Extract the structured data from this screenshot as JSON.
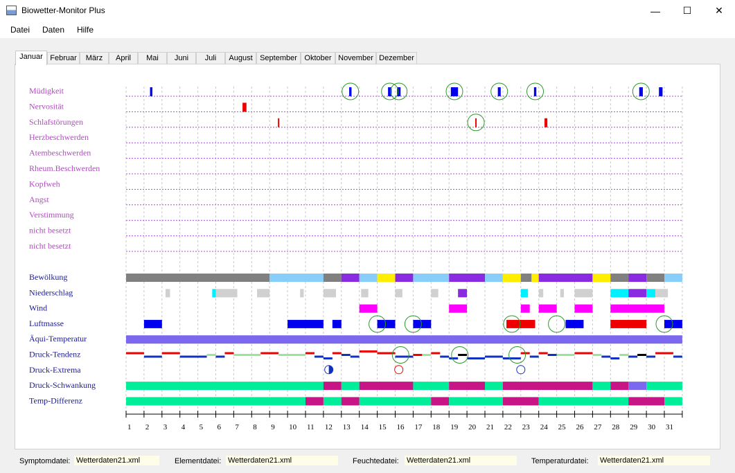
{
  "window": {
    "title": "Biowetter-Monitor Plus",
    "minimize": "—",
    "maximize": "☐",
    "close": "✕",
    "icon": "app-icon"
  },
  "menu": [
    "Datei",
    "Daten",
    "Hilfe"
  ],
  "tabs": [
    "Januar",
    "Februar",
    "März",
    "April",
    "Mai",
    "Juni",
    "Juli",
    "August",
    "September",
    "Oktober",
    "November",
    "Dezember"
  ],
  "active_tab": "Januar",
  "symptoms": [
    "Müdigkeit",
    "Nervosität",
    "Schlafstörungen",
    "Herzbeschwerden",
    "Atembeschwerden",
    "Rheum.Beschwerden",
    "Kopfweh",
    "Angst",
    "Verstimmung",
    "nicht besetzt",
    "nicht besetzt"
  ],
  "elements": [
    "Bewölkung",
    "Niederschlag",
    "Wind",
    "Luftmasse",
    "Äqui-Temperatur",
    "Druck-Tendenz",
    "Druck-Extrema",
    "Druck-Schwankung",
    "Temp-Differenz"
  ],
  "days": [
    "1",
    "2",
    "3",
    "4",
    "5",
    "6",
    "7",
    "8",
    "9",
    "10",
    "11",
    "12",
    "13",
    "14",
    "15",
    "16",
    "17",
    "18",
    "19",
    "20",
    "21",
    "22",
    "23",
    "24",
    "25",
    "26",
    "27",
    "28",
    "29",
    "30",
    "31"
  ],
  "colors": {
    "symptom_label": "#b04cc0",
    "element_label": "#1a1a99",
    "guide": "#a34fd0",
    "vgrid": "#c8c8c8",
    "blue": "#0000ee",
    "red": "#ee0000",
    "circle": "#2a9a2a",
    "gray": "#808080",
    "skyblue": "#87cefa",
    "purple": "#8a2be2",
    "yellow": "#ffee00",
    "lightgray": "#d0d0d0",
    "cyan": "#00f0ff",
    "magenta": "#ff00ff",
    "slate": "#7b68ee",
    "green": "#00ee99",
    "crimson": "#c71585",
    "lightgreen": "#98e698",
    "darkblue": "#1030c0",
    "black": "#000000"
  },
  "status": [
    {
      "label": "Symptomdatei:",
      "value": "Wetterdaten21.xml"
    },
    {
      "label": "Elementdatei:",
      "value": "Wetterdaten21.xml"
    },
    {
      "label": "Feuchtedatei:",
      "value": "Wetterdaten21.xml"
    },
    {
      "label": "Temperaturdatei:",
      "value": "Wetterdaten21.xml"
    }
  ],
  "chart_data": {
    "type": "timeline",
    "x_range": [
      1,
      31
    ],
    "symptom_marks": [
      {
        "row": 0,
        "day": 2.4,
        "w": 0.13,
        "color": "blue"
      },
      {
        "row": 0,
        "day": 13.5,
        "w": 0.13,
        "color": "blue"
      },
      {
        "row": 0,
        "day": 15.7,
        "w": 0.2,
        "color": "blue"
      },
      {
        "row": 0,
        "day": 16.2,
        "w": 0.2,
        "color": "blue"
      },
      {
        "row": 0,
        "day": 19.3,
        "w": 0.4,
        "color": "blue"
      },
      {
        "row": 0,
        "day": 21.8,
        "w": 0.16,
        "color": "blue"
      },
      {
        "row": 0,
        "day": 23.8,
        "w": 0.13,
        "color": "blue"
      },
      {
        "row": 0,
        "day": 29.7,
        "w": 0.2,
        "color": "blue"
      },
      {
        "row": 0,
        "day": 30.8,
        "w": 0.2,
        "color": "blue"
      },
      {
        "row": 1,
        "day": 7.6,
        "w": 0.22,
        "color": "red"
      },
      {
        "row": 2,
        "day": 9.5,
        "w": 0.07,
        "color": "red"
      },
      {
        "row": 2,
        "day": 20.5,
        "w": 0.07,
        "color": "red"
      },
      {
        "row": 2,
        "day": 24.4,
        "w": 0.16,
        "color": "red"
      }
    ],
    "symptom_circles": [
      {
        "row": 0,
        "day": 13.5
      },
      {
        "row": 0,
        "day": 15.7
      },
      {
        "row": 0,
        "day": 16.2
      },
      {
        "row": 0,
        "day": 19.3
      },
      {
        "row": 0,
        "day": 21.8
      },
      {
        "row": 0,
        "day": 23.8
      },
      {
        "row": 0,
        "day": 29.7
      },
      {
        "row": 2,
        "day": 20.5
      }
    ],
    "element_bars": [
      {
        "row": 0,
        "from": 1,
        "to": 9,
        "color": "gray"
      },
      {
        "row": 0,
        "from": 9,
        "to": 12,
        "color": "skyblue"
      },
      {
        "row": 0,
        "from": 12,
        "to": 13,
        "color": "gray"
      },
      {
        "row": 0,
        "from": 13,
        "to": 14,
        "color": "purple"
      },
      {
        "row": 0,
        "from": 14,
        "to": 15,
        "color": "skyblue"
      },
      {
        "row": 0,
        "from": 15,
        "to": 16,
        "color": "yellow"
      },
      {
        "row": 0,
        "from": 16,
        "to": 17,
        "color": "purple"
      },
      {
        "row": 0,
        "from": 17,
        "to": 19,
        "color": "skyblue"
      },
      {
        "row": 0,
        "from": 19,
        "to": 21,
        "color": "purple"
      },
      {
        "row": 0,
        "from": 21,
        "to": 22,
        "color": "skyblue"
      },
      {
        "row": 0,
        "from": 22,
        "to": 23,
        "color": "yellow"
      },
      {
        "row": 0,
        "from": 23,
        "to": 23.6,
        "color": "gray"
      },
      {
        "row": 0,
        "from": 23.6,
        "to": 24,
        "color": "yellow"
      },
      {
        "row": 0,
        "from": 24,
        "to": 27,
        "color": "purple"
      },
      {
        "row": 0,
        "from": 27,
        "to": 28,
        "color": "yellow"
      },
      {
        "row": 0,
        "from": 28,
        "to": 29,
        "color": "gray"
      },
      {
        "row": 0,
        "from": 29,
        "to": 30,
        "color": "purple"
      },
      {
        "row": 0,
        "from": 30,
        "to": 31,
        "color": "gray"
      },
      {
        "row": 0,
        "from": 31,
        "to": 32,
        "color": "skyblue"
      },
      {
        "row": 1,
        "from": 3.2,
        "to": 3.45,
        "color": "lightgray"
      },
      {
        "row": 1,
        "from": 5.8,
        "to": 6,
        "color": "cyan"
      },
      {
        "row": 1,
        "from": 6,
        "to": 7.2,
        "color": "lightgray"
      },
      {
        "row": 1,
        "from": 8.3,
        "to": 9,
        "color": "lightgray"
      },
      {
        "row": 1,
        "from": 10.7,
        "to": 10.9,
        "color": "lightgray"
      },
      {
        "row": 1,
        "from": 12,
        "to": 12.7,
        "color": "lightgray"
      },
      {
        "row": 1,
        "from": 14.1,
        "to": 14.5,
        "color": "lightgray"
      },
      {
        "row": 1,
        "from": 16,
        "to": 16.4,
        "color": "lightgray"
      },
      {
        "row": 1,
        "from": 18,
        "to": 18.4,
        "color": "lightgray"
      },
      {
        "row": 1,
        "from": 19.5,
        "to": 20,
        "color": "purple"
      },
      {
        "row": 1,
        "from": 23,
        "to": 23.4,
        "color": "cyan"
      },
      {
        "row": 1,
        "from": 24,
        "to": 24.25,
        "color": "lightgray"
      },
      {
        "row": 1,
        "from": 25.2,
        "to": 25.4,
        "color": "lightgray"
      },
      {
        "row": 1,
        "from": 26,
        "to": 27,
        "color": "lightgray"
      },
      {
        "row": 1,
        "from": 28,
        "to": 29,
        "color": "cyan"
      },
      {
        "row": 1,
        "from": 29,
        "to": 30,
        "color": "purple"
      },
      {
        "row": 1,
        "from": 30,
        "to": 30.5,
        "color": "cyan"
      },
      {
        "row": 1,
        "from": 30.5,
        "to": 31.2,
        "color": "lightgray"
      },
      {
        "row": 2,
        "from": 14,
        "to": 15,
        "color": "magenta"
      },
      {
        "row": 2,
        "from": 19,
        "to": 20,
        "color": "magenta"
      },
      {
        "row": 2,
        "from": 23,
        "to": 23.5,
        "color": "magenta"
      },
      {
        "row": 2,
        "from": 24,
        "to": 25,
        "color": "magenta"
      },
      {
        "row": 2,
        "from": 26,
        "to": 27,
        "color": "magenta"
      },
      {
        "row": 2,
        "from": 28,
        "to": 31,
        "color": "magenta"
      },
      {
        "row": 3,
        "from": 2,
        "to": 3,
        "color": "blue"
      },
      {
        "row": 3,
        "from": 10,
        "to": 12,
        "color": "blue"
      },
      {
        "row": 3,
        "from": 12.5,
        "to": 13,
        "color": "blue"
      },
      {
        "row": 3,
        "from": 15,
        "to": 16,
        "color": "blue"
      },
      {
        "row": 3,
        "from": 17,
        "to": 18,
        "color": "blue"
      },
      {
        "row": 3,
        "from": 22.2,
        "to": 23.8,
        "color": "red"
      },
      {
        "row": 3,
        "from": 25.5,
        "to": 26.5,
        "color": "blue"
      },
      {
        "row": 3,
        "from": 28,
        "to": 30,
        "color": "red"
      },
      {
        "row": 3,
        "from": 31,
        "to": 32,
        "color": "blue"
      },
      {
        "row": 4,
        "from": 1,
        "to": 32,
        "color": "slate"
      },
      {
        "row": 7,
        "from": 1,
        "to": 12,
        "color": "green"
      },
      {
        "row": 7,
        "from": 12,
        "to": 13,
        "color": "crimson"
      },
      {
        "row": 7,
        "from": 13,
        "to": 14,
        "color": "green"
      },
      {
        "row": 7,
        "from": 14,
        "to": 17,
        "color": "crimson"
      },
      {
        "row": 7,
        "from": 17,
        "to": 19,
        "color": "green"
      },
      {
        "row": 7,
        "from": 19,
        "to": 21,
        "color": "crimson"
      },
      {
        "row": 7,
        "from": 21,
        "to": 22,
        "color": "green"
      },
      {
        "row": 7,
        "from": 22,
        "to": 27,
        "color": "crimson"
      },
      {
        "row": 7,
        "from": 27,
        "to": 28,
        "color": "green"
      },
      {
        "row": 7,
        "from": 28,
        "to": 29,
        "color": "crimson"
      },
      {
        "row": 7,
        "from": 29,
        "to": 30,
        "color": "slate"
      },
      {
        "row": 7,
        "from": 30,
        "to": 32,
        "color": "green"
      },
      {
        "row": 8,
        "from": 1,
        "to": 11,
        "color": "green"
      },
      {
        "row": 8,
        "from": 11,
        "to": 12,
        "color": "crimson"
      },
      {
        "row": 8,
        "from": 12,
        "to": 13,
        "color": "green"
      },
      {
        "row": 8,
        "from": 13,
        "to": 14,
        "color": "crimson"
      },
      {
        "row": 8,
        "from": 14,
        "to": 18,
        "color": "green"
      },
      {
        "row": 8,
        "from": 18,
        "to": 19,
        "color": "crimson"
      },
      {
        "row": 8,
        "from": 19,
        "to": 22,
        "color": "green"
      },
      {
        "row": 8,
        "from": 22,
        "to": 24,
        "color": "crimson"
      },
      {
        "row": 8,
        "from": 24,
        "to": 29,
        "color": "green"
      },
      {
        "row": 8,
        "from": 29,
        "to": 31,
        "color": "crimson"
      },
      {
        "row": 8,
        "from": 31,
        "to": 32,
        "color": "green"
      }
    ],
    "element_circles": [
      {
        "row": 3,
        "day": 15
      },
      {
        "row": 3,
        "day": 17
      },
      {
        "row": 3,
        "day": 22.5
      },
      {
        "row": 3,
        "day": 25
      },
      {
        "row": 3,
        "day": 31
      },
      {
        "row": 5,
        "day": 16.3
      },
      {
        "row": 5,
        "day": 19.6
      },
      {
        "row": 5,
        "day": 22.8
      }
    ],
    "tendency_segments": [
      {
        "from": 1,
        "to": 2,
        "level": -1,
        "color": "red"
      },
      {
        "from": 2,
        "to": 3,
        "level": 1,
        "color": "darkblue"
      },
      {
        "from": 3,
        "to": 4,
        "level": -1,
        "color": "red"
      },
      {
        "from": 4,
        "to": 5.5,
        "level": 1,
        "color": "darkblue"
      },
      {
        "from": 5.5,
        "to": 6,
        "level": 0,
        "color": "lightgreen"
      },
      {
        "from": 6,
        "to": 6.5,
        "level": 1,
        "color": "darkblue"
      },
      {
        "from": 6.5,
        "to": 7,
        "level": -1,
        "color": "red"
      },
      {
        "from": 7,
        "to": 8.5,
        "level": 0,
        "color": "lightgreen"
      },
      {
        "from": 8.5,
        "to": 9.5,
        "level": -1,
        "color": "red"
      },
      {
        "from": 9.5,
        "to": 11,
        "level": 0,
        "color": "lightgreen"
      },
      {
        "from": 11,
        "to": 11.5,
        "level": -1,
        "color": "red"
      },
      {
        "from": 11.5,
        "to": 12,
        "level": 1,
        "color": "darkblue"
      },
      {
        "from": 12,
        "to": 12.5,
        "level": 2,
        "color": "darkblue"
      },
      {
        "from": 12.5,
        "to": 13,
        "level": -1,
        "color": "red"
      },
      {
        "from": 13,
        "to": 13.5,
        "level": 0,
        "color": "darkblue"
      },
      {
        "from": 13.5,
        "to": 14,
        "level": 1,
        "color": "darkblue"
      },
      {
        "from": 14,
        "to": 15,
        "level": -2,
        "color": "red"
      },
      {
        "from": 15,
        "to": 16,
        "level": -1,
        "color": "red"
      },
      {
        "from": 16,
        "to": 17,
        "level": 1,
        "color": "darkblue"
      },
      {
        "from": 17,
        "to": 17.5,
        "level": 0,
        "color": "red"
      },
      {
        "from": 17.5,
        "to": 18,
        "level": 0,
        "color": "lightgreen"
      },
      {
        "from": 18,
        "to": 18.5,
        "level": -1,
        "color": "red"
      },
      {
        "from": 18.5,
        "to": 19,
        "level": 1,
        "color": "darkblue"
      },
      {
        "from": 19,
        "to": 19.5,
        "level": 2,
        "color": "darkblue"
      },
      {
        "from": 19.5,
        "to": 20,
        "level": 0,
        "color": "black"
      },
      {
        "from": 20,
        "to": 21,
        "level": 2,
        "color": "darkblue"
      },
      {
        "from": 21,
        "to": 22,
        "level": 1,
        "color": "darkblue"
      },
      {
        "from": 22,
        "to": 23,
        "level": 2,
        "color": "darkblue"
      },
      {
        "from": 23,
        "to": 23.5,
        "level": -1,
        "color": "red"
      },
      {
        "from": 23.5,
        "to": 24,
        "level": 1,
        "color": "darkblue"
      },
      {
        "from": 24,
        "to": 24.5,
        "level": -1,
        "color": "red"
      },
      {
        "from": 24.5,
        "to": 25,
        "level": 0,
        "color": "darkblue"
      },
      {
        "from": 25,
        "to": 26,
        "level": 0,
        "color": "lightgreen"
      },
      {
        "from": 26,
        "to": 27,
        "level": -1,
        "color": "red"
      },
      {
        "from": 27,
        "to": 27.5,
        "level": 0,
        "color": "lightgreen"
      },
      {
        "from": 27.5,
        "to": 28,
        "level": 1,
        "color": "darkblue"
      },
      {
        "from": 28,
        "to": 28.5,
        "level": 2,
        "color": "darkblue"
      },
      {
        "from": 28.5,
        "to": 29,
        "level": 0,
        "color": "lightgreen"
      },
      {
        "from": 29,
        "to": 29.5,
        "level": 1,
        "color": "darkblue"
      },
      {
        "from": 29.5,
        "to": 30,
        "level": 0,
        "color": "black"
      },
      {
        "from": 30,
        "to": 30.5,
        "level": 1,
        "color": "darkblue"
      },
      {
        "from": 30.5,
        "to": 31.5,
        "level": -1,
        "color": "red"
      },
      {
        "from": 31.5,
        "to": 32,
        "level": 1,
        "color": "darkblue"
      }
    ],
    "extrema_markers": [
      {
        "day": 12.3,
        "kind": "half",
        "color": "darkblue"
      },
      {
        "day": 16.2,
        "kind": "ring",
        "color": "red"
      },
      {
        "day": 23,
        "kind": "ring",
        "color": "darkblue"
      }
    ]
  }
}
